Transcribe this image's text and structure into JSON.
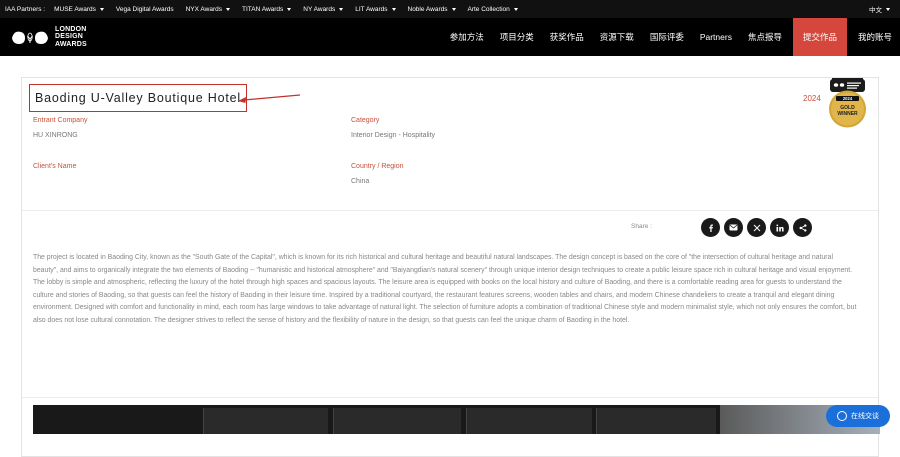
{
  "partner_bar": {
    "label": "IAA Partners :",
    "items": [
      {
        "label": "MUSE Awards"
      },
      {
        "label": "Vega Digital Awards"
      },
      {
        "label": "NYX Awards"
      },
      {
        "label": "TITAN Awards"
      },
      {
        "label": "NY Awards"
      },
      {
        "label": "LIT Awards"
      },
      {
        "label": "Noble Awards"
      },
      {
        "label": "Arte Collection"
      }
    ],
    "language": "中文"
  },
  "nav": {
    "logo_lines": [
      "LONDON",
      "DESIGN",
      "AWARDS"
    ],
    "items": [
      {
        "label": "参加方法"
      },
      {
        "label": "项目分类"
      },
      {
        "label": "获奖作品"
      },
      {
        "label": "资源下载"
      },
      {
        "label": "国际评委"
      },
      {
        "label": "Partners"
      },
      {
        "label": "焦点报导"
      },
      {
        "label": "提交作品"
      },
      {
        "label": "我的账号"
      }
    ]
  },
  "entry": {
    "title": "Baoding U-Valley Boutique Hotel",
    "year": "2024",
    "badge": {
      "year": "2024",
      "line1": "GOLD",
      "line2": "WINNER",
      "top_text": "LONDON DESIGN AWARDS"
    },
    "fields": {
      "entrant_label": "Entrant Company",
      "entrant_value": "HU XINRONG",
      "category_label": "Category",
      "category_value": "Interior Design - Hospitality",
      "client_label": "Client's Name",
      "client_value": "",
      "country_label": "Country / Region",
      "country_value": "China"
    },
    "share_label": "Share :",
    "share_icons": [
      "facebook-icon",
      "email-icon",
      "x-icon",
      "linkedin-icon",
      "share-icon"
    ],
    "description": "The project is located in Baoding City, known as the \"South Gate of the Capital\", which is known for its rich historical and cultural heritage and beautiful natural landscapes. The design concept is based on the core of \"the intersection of cultural heritage and natural beauty\", and aims to organically integrate the two elements of Baoding -- \"humanistic and historical atmosphere\" and \"Baiyangdian's natural scenery\" through unique interior design techniques to create a public leisure space rich in cultural heritage and visual enjoyment. The lobby is simple and atmospheric, reflecting the luxury of the hotel through high spaces and spacious layouts. The leisure area is equipped with books on the local history and culture of Baoding, and there is a comfortable reading area for guests to understand the culture and stories of Baoding, so that guests can feel the history of Baoding in their leisure time. Inspired by a traditional courtyard, the restaurant features screens, wooden tables and chairs, and modern Chinese chandeliers to create a tranquil and elegant dining environment. Designed with comfort and functionality in mind, each room has large windows to take advantage of natural light. The selection of furniture adopts a combination of traditional Chinese style and modern minimalist style, which not only ensures the comfort, but also does not lose cultural connotation. The designer strives to reflect the sense of history and the flexibility of nature in the design, so that guests can feel the unique charm of Baoding in the hotel."
  },
  "chat": {
    "label": "在线交谈"
  },
  "colors": {
    "accent": "#d5473c",
    "label": "#c7513a",
    "chat": "#1a6fd8"
  }
}
